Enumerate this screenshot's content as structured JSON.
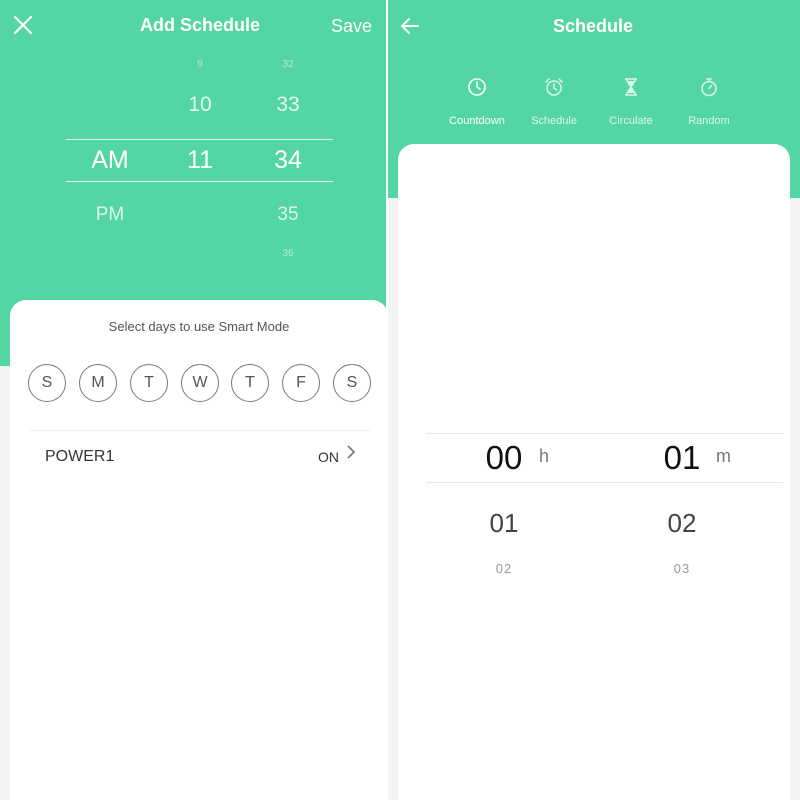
{
  "add_schedule": {
    "title": "Add Schedule",
    "save_label": "Save",
    "close_icon": "close-icon",
    "time_picker": {
      "period_options": [
        "AM",
        "PM"
      ],
      "selected_period": "AM",
      "hour_options": [
        "9",
        "10",
        "11"
      ],
      "selected_hour": "11",
      "minute_options": [
        "32",
        "33",
        "34",
        "35",
        "36"
      ],
      "selected_minute": "34"
    },
    "days_title": "Select days to use Smart Mode",
    "days": [
      "S",
      "M",
      "T",
      "W",
      "T",
      "F",
      "S"
    ],
    "action_row": {
      "label": "POWER1",
      "value": "ON",
      "icon": "chevron-right-icon"
    }
  },
  "schedule": {
    "title": "Schedule",
    "back_icon": "back-arrow-icon",
    "tabs": [
      {
        "label": "Countdown",
        "icon": "clock-icon"
      },
      {
        "label": "Schedule",
        "icon": "alarm-clock-icon"
      },
      {
        "label": "Circulate",
        "icon": "hourglass-icon"
      },
      {
        "label": "Random",
        "icon": "stopwatch-icon"
      }
    ],
    "duration_picker": {
      "hours": {
        "selected": "00",
        "next": "01",
        "next2": "02",
        "unit": "h"
      },
      "minutes": {
        "selected": "01",
        "next": "02",
        "next2": "03",
        "unit": "m"
      }
    }
  },
  "colors": {
    "accent": "#53d6a3",
    "background": "#f3f4f4",
    "card": "#ffffff"
  }
}
